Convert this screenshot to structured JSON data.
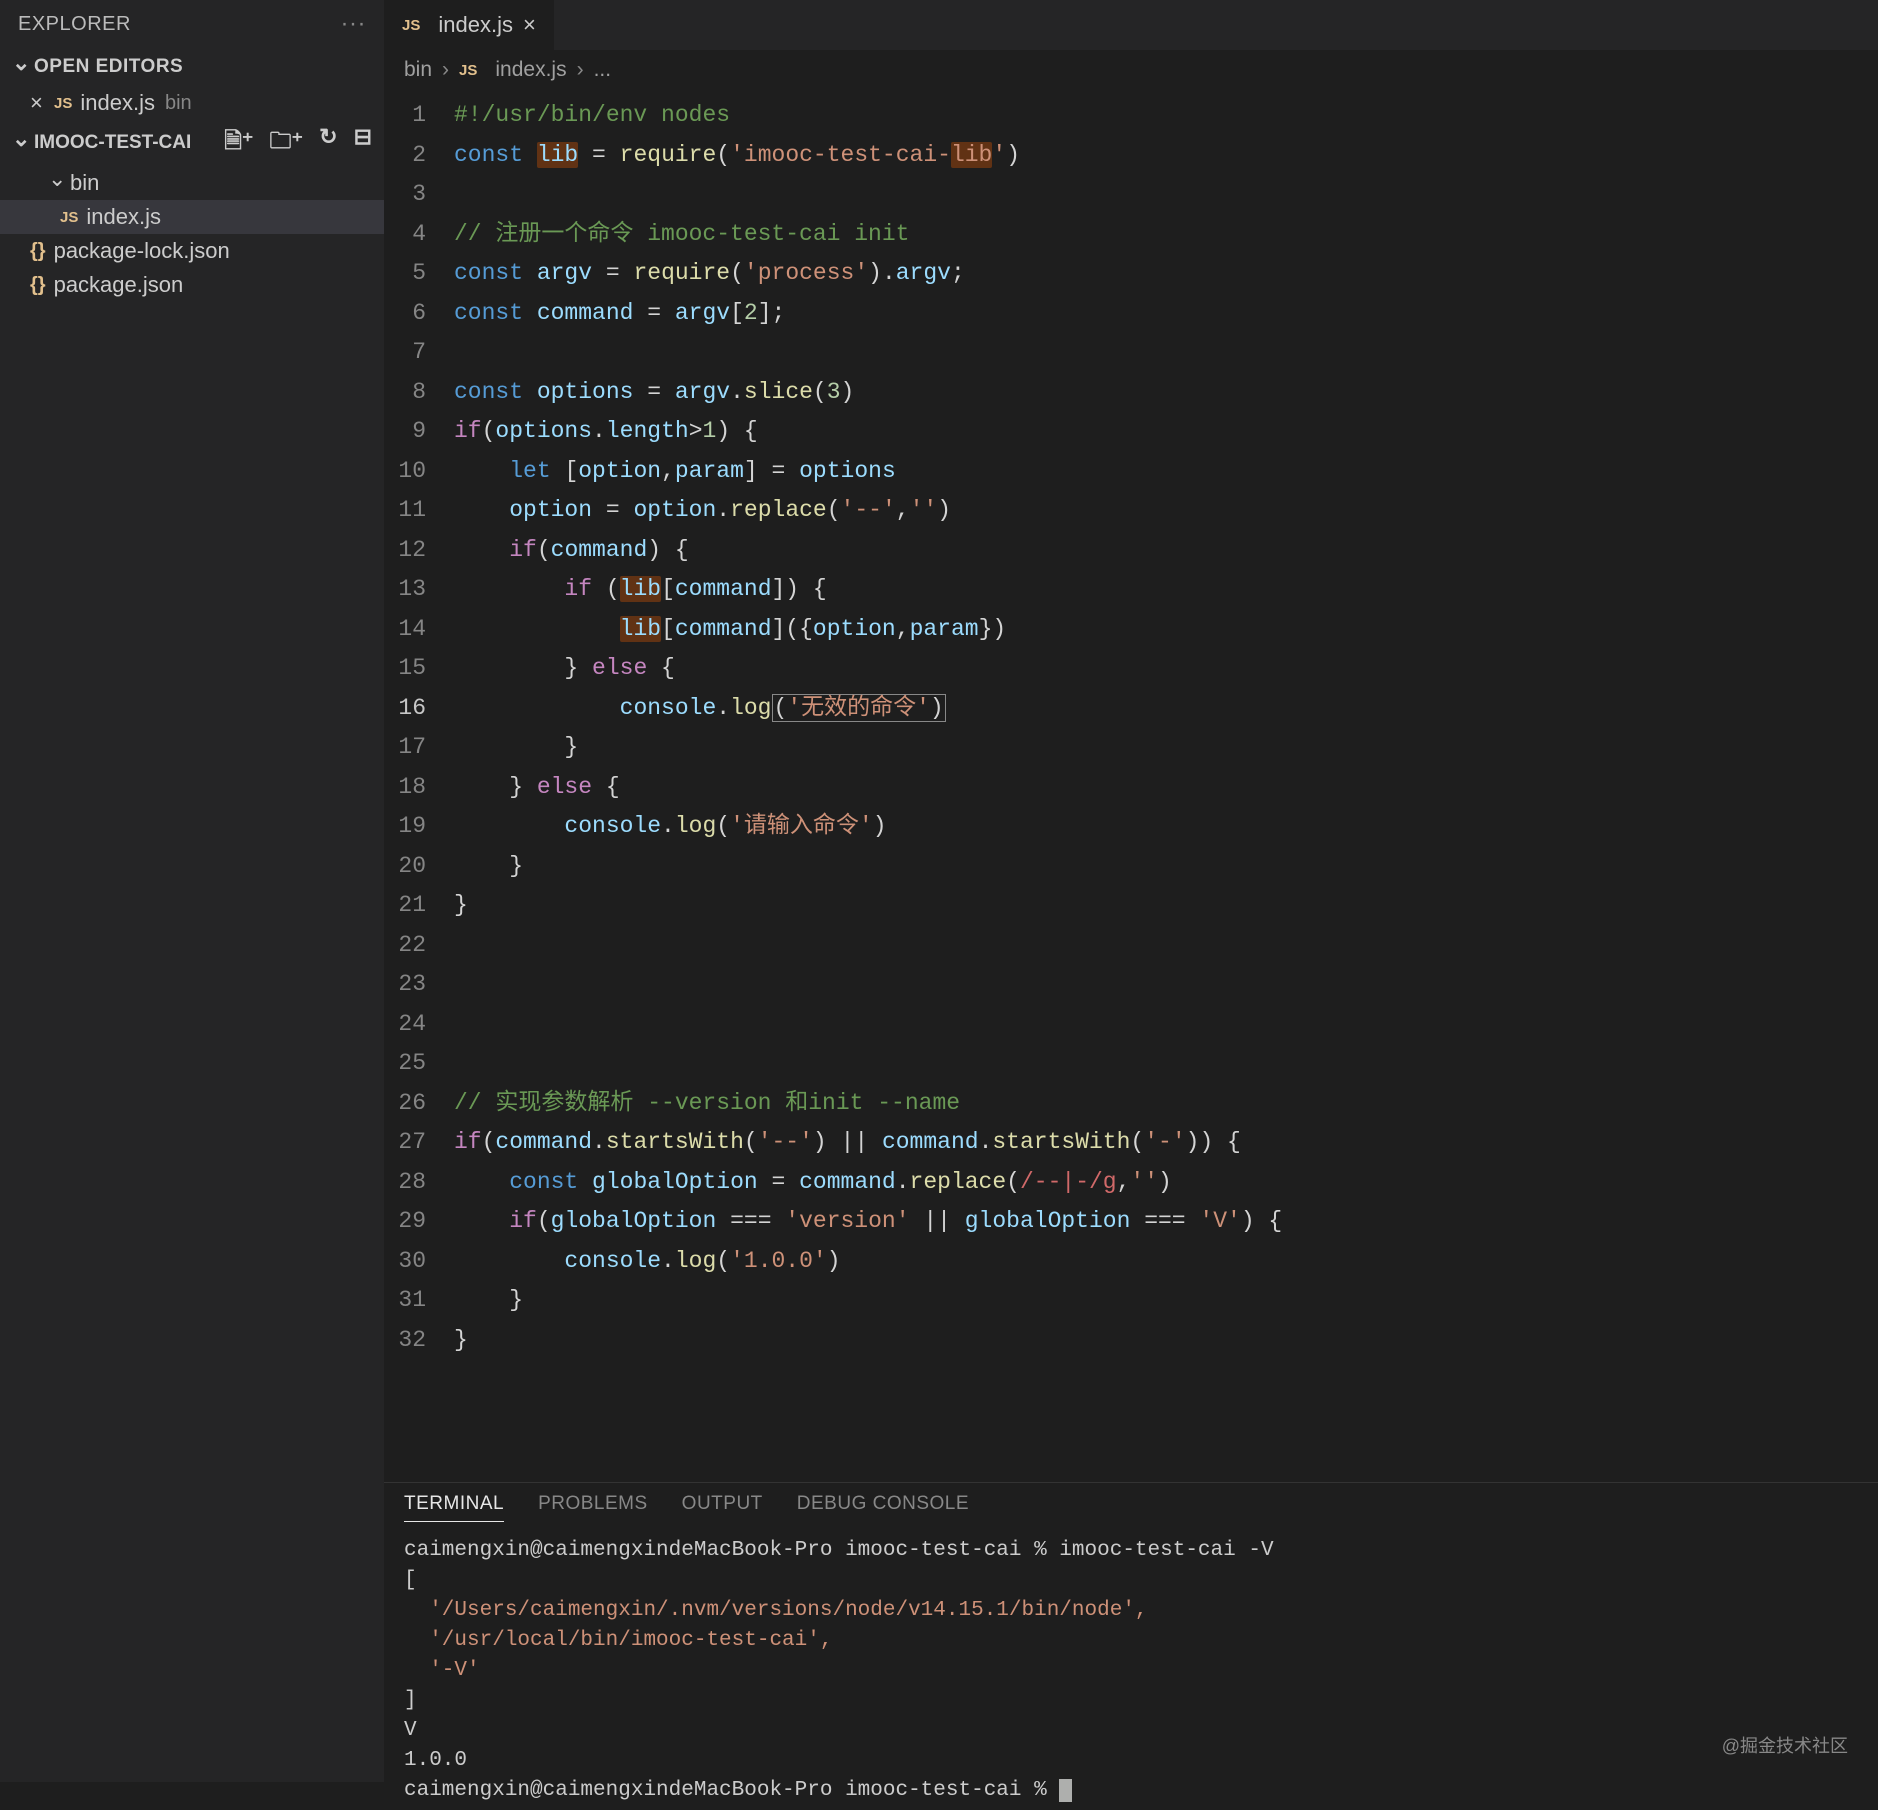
{
  "sidebar": {
    "explorer": "EXPLORER",
    "openEditors": "OPEN EDITORS",
    "project": "IMOOC-TEST-CAI",
    "openFile": {
      "name": "index.js",
      "folder": "bin",
      "badge": "JS"
    },
    "tree": {
      "bin": "bin",
      "indexjs": "index.js",
      "pkgLock": "package-lock.json",
      "pkg": "package.json"
    }
  },
  "tab": {
    "badge": "JS",
    "name": "index.js"
  },
  "breadcrumb": {
    "a": "bin",
    "b": "index.js",
    "c": "...",
    "badge": "JS"
  },
  "lines": [
    "1",
    "2",
    "3",
    "4",
    "5",
    "6",
    "7",
    "8",
    "9",
    "10",
    "11",
    "12",
    "13",
    "14",
    "15",
    "16",
    "17",
    "18",
    "19",
    "20",
    "21",
    "22",
    "23",
    "24",
    "25",
    "26",
    "27",
    "28",
    "29",
    "30",
    "31",
    "32"
  ],
  "currentLine": 16,
  "code": {
    "l1": "#!/usr/bin/env nodes",
    "l2a": "const",
    "l2b": "lib",
    "l2c": " = ",
    "l2d": "require",
    "l2e": "(",
    "l2f": "'imooc-test-cai-",
    "l2g": "lib",
    "l2h": "'",
    "l2i": ")",
    "l4": "// 注册一个命令 imooc-test-cai init",
    "l5a": "const",
    "l5b": "argv",
    "l5c": " = ",
    "l5d": "require",
    "l5e": "(",
    "l5f": "'process'",
    "l5g": ").",
    "l5h": "argv",
    "l5i": ";",
    "l6a": "const",
    "l6b": "command",
    "l6c": " = ",
    "l6d": "argv",
    "l6e": "[",
    "l6f": "2",
    "l6g": "];",
    "l8a": "const",
    "l8b": "options",
    "l8c": " = ",
    "l8d": "argv",
    "l8e": ".",
    "l8f": "slice",
    "l8g": "(",
    "l8h": "3",
    "l8i": ")",
    "l9a": "if",
    "l9b": "(",
    "l9c": "options",
    "l9d": ".",
    "l9e": "length",
    "l9f": ">",
    "l9g": "1",
    "l9h": ") {",
    "l10a": "let",
    "l10b": " [",
    "l10c": "option",
    "l10d": ",",
    "l10e": "param",
    "l10f": "] = ",
    "l10g": "options",
    "l11a": "option",
    "l11b": " = ",
    "l11c": "option",
    "l11d": ".",
    "l11e": "replace",
    "l11f": "(",
    "l11g": "'--'",
    "l11h": ",",
    "l11i": "''",
    "l11j": ")",
    "l12a": "if",
    "l12b": "(",
    "l12c": "command",
    "l12d": ") {",
    "l13a": "if",
    "l13b": " (",
    "l13c": "lib",
    "l13d": "[",
    "l13e": "command",
    "l13f": "]) {",
    "l14a": "lib",
    "l14b": "[",
    "l14c": "command",
    "l14d": "]({",
    "l14e": "option",
    "l14f": ",",
    "l14g": "param",
    "l14h": "})",
    "l15a": "} ",
    "l15b": "else",
    "l15c": " {",
    "l16a": "console",
    "l16b": ".",
    "l16c": "log",
    "l16d": "(",
    "l16e": "'无效的命令'",
    "l16f": ")",
    "l17": "}",
    "l18a": "} ",
    "l18b": "else",
    "l18c": " {",
    "l19a": "console",
    "l19b": ".",
    "l19c": "log",
    "l19d": "(",
    "l19e": "'请输入命令'",
    "l19f": ")",
    "l20": "}",
    "l21": "}",
    "l26": "// 实现参数解析 --version 和init --name",
    "l27a": "if",
    "l27b": "(",
    "l27c": "command",
    "l27d": ".",
    "l27e": "startsWith",
    "l27f": "(",
    "l27g": "'--'",
    "l27h": ") || ",
    "l27i": "command",
    "l27j": ".",
    "l27k": "startsWith",
    "l27l": "(",
    "l27m": "'-'",
    "l27n": ")) {",
    "l28a": "const",
    "l28b": "globalOption",
    "l28c": " = ",
    "l28d": "command",
    "l28e": ".",
    "l28f": "replace",
    "l28g": "(",
    "l28h": "/--|-/g",
    "l28i": ",",
    "l28j": "''",
    "l28k": ")",
    "l29a": "if",
    "l29b": "(",
    "l29c": "globalOption",
    "l29d": " === ",
    "l29e": "'version'",
    "l29f": " || ",
    "l29g": "globalOption",
    "l29h": " === ",
    "l29i": "'V'",
    "l29j": ") {",
    "l30a": "console",
    "l30b": ".",
    "l30c": "log",
    "l30d": "(",
    "l30e": "'1.0.0'",
    "l30f": ")",
    "l31": "}",
    "l32": "}"
  },
  "panel": {
    "tabs": {
      "terminal": "TERMINAL",
      "problems": "PROBLEMS",
      "output": "OUTPUT",
      "debug": "DEBUG CONSOLE"
    }
  },
  "terminal": {
    "l1": "caimengxin@caimengxindeMacBook-Pro imooc-test-cai % imooc-test-cai -V",
    "l2": "[",
    "l3": "  '/Users/caimengxin/.nvm/versions/node/v14.15.1/bin/node',",
    "l4": "  '/usr/local/bin/imooc-test-cai',",
    "l5": "  '-V'",
    "l6": "]",
    "l7": "V",
    "l8": "1.0.0",
    "l9": "caimengxin@caimengxindeMacBook-Pro imooc-test-cai % "
  },
  "watermark": "@掘金技术社区"
}
